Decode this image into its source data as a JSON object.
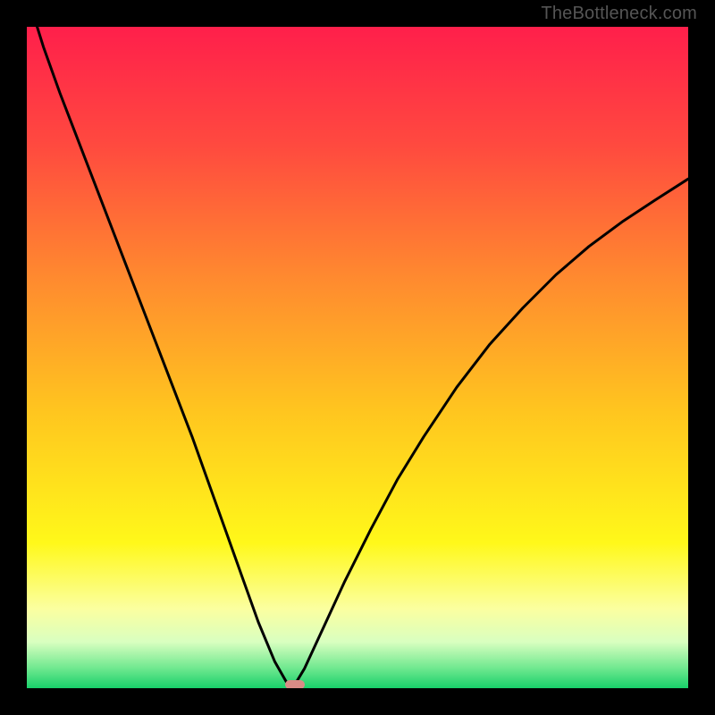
{
  "watermark": "TheBottleneck.com",
  "gradient": {
    "stops": [
      {
        "offset": 0.0,
        "color": "#ff1f4b"
      },
      {
        "offset": 0.18,
        "color": "#ff4a3f"
      },
      {
        "offset": 0.38,
        "color": "#ff8a2f"
      },
      {
        "offset": 0.58,
        "color": "#ffc51f"
      },
      {
        "offset": 0.78,
        "color": "#fff81a"
      },
      {
        "offset": 0.88,
        "color": "#fbffa0"
      },
      {
        "offset": 0.93,
        "color": "#d9ffc0"
      },
      {
        "offset": 0.97,
        "color": "#6fe88f"
      },
      {
        "offset": 1.0,
        "color": "#18d06a"
      }
    ]
  },
  "chart_data": {
    "type": "line",
    "title": "",
    "xlabel": "",
    "ylabel": "",
    "xlim": [
      0,
      1
    ],
    "ylim": [
      0,
      1
    ],
    "notch_x": 0.4,
    "marker": {
      "x": 0.405,
      "y": 0.995
    },
    "series": [
      {
        "name": "bottleneck-curve",
        "x": [
          0.0,
          0.025,
          0.05,
          0.075,
          0.1,
          0.125,
          0.15,
          0.175,
          0.2,
          0.225,
          0.25,
          0.275,
          0.3,
          0.325,
          0.35,
          0.375,
          0.395,
          0.405,
          0.42,
          0.45,
          0.48,
          0.52,
          0.56,
          0.6,
          0.65,
          0.7,
          0.75,
          0.8,
          0.85,
          0.9,
          0.95,
          1.0
        ],
        "values": [
          1.05,
          0.97,
          0.9,
          0.835,
          0.77,
          0.705,
          0.64,
          0.575,
          0.51,
          0.445,
          0.38,
          0.31,
          0.24,
          0.17,
          0.1,
          0.04,
          0.005,
          0.005,
          0.03,
          0.095,
          0.16,
          0.24,
          0.315,
          0.38,
          0.455,
          0.52,
          0.575,
          0.625,
          0.668,
          0.705,
          0.738,
          0.77
        ]
      }
    ]
  }
}
